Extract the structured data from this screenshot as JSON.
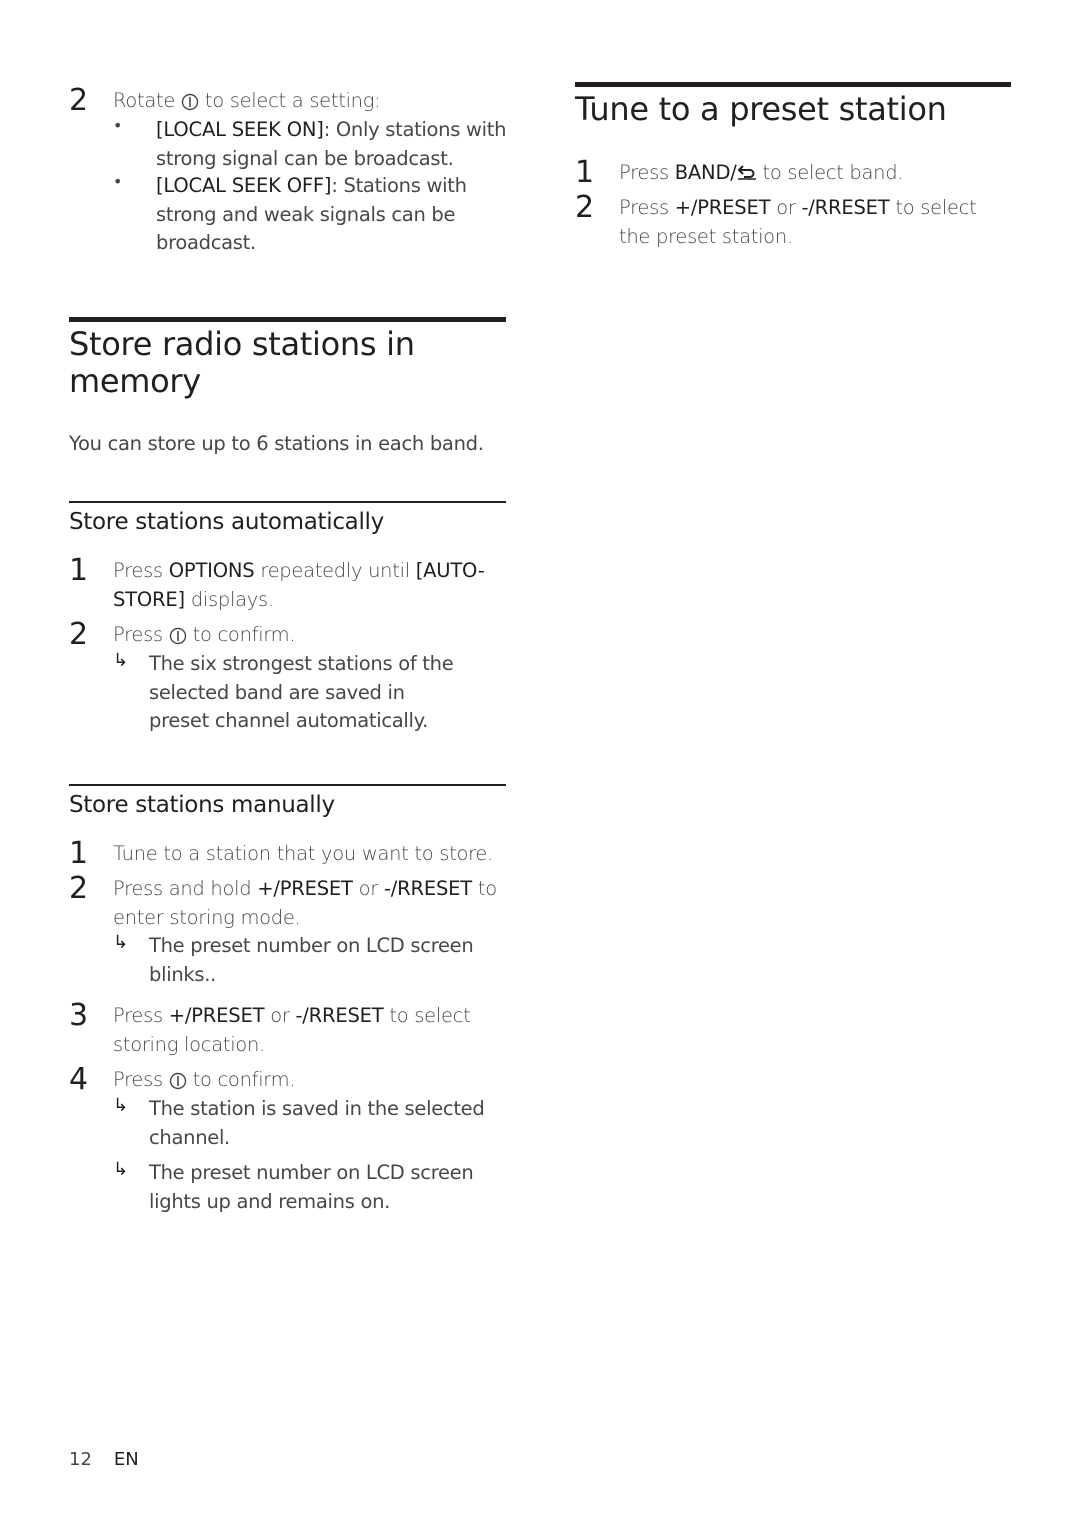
{
  "left_column": {
    "top_step": {
      "number": "2",
      "text_before": "Rotate",
      "icon": "dial-knob-icon",
      "text_after": "to select a setting:",
      "bullets": [
        {
          "mark": "•",
          "keyword": "[LOCAL SEEK ON]",
          "text": ": Only stations with strong signal can be broadcast."
        },
        {
          "mark": "•",
          "keyword": "[LOCAL SEEK OFF]",
          "text": ": Stations with strong and weak signals can be broadcast."
        }
      ]
    },
    "section": {
      "title": "Store radio stations in memory",
      "intro": "You can store up to 6 stations in each band."
    },
    "auto": {
      "title": "Store stations automatically",
      "steps": [
        {
          "number": "1",
          "pre": "Press ",
          "kw1": "OPTIONS",
          "mid": " repeatedly until ",
          "kw2": "[AUTO-STORE]",
          "post": " displays."
        },
        {
          "number": "2",
          "pre": "Press",
          "icon": "dial-knob-icon",
          "post": "to confirm."
        }
      ],
      "results": [
        {
          "arrow": "↳",
          "text": "The six strongest stations of the selected band are saved in preset channel automatically."
        }
      ]
    },
    "manual": {
      "title": "Store stations manually",
      "steps": [
        {
          "number": "1",
          "text": "Tune to a station that you want to store."
        },
        {
          "number": "2",
          "pre": "Press and hold ",
          "kw1": "+/PRESET",
          "mid": " or ",
          "kw2": "-/RRESET",
          "post": " to enter storing mode."
        },
        {
          "number": "3",
          "pre": "Press ",
          "kw1": "+/PRESET",
          "mid": " or ",
          "kw2": "-/RRESET",
          "post": " to select storing location."
        },
        {
          "number": "4",
          "pre": "Press",
          "icon": "dial-knob-icon",
          "post": "to confirm."
        }
      ],
      "results": [
        {
          "arrow": "↳",
          "text": "The preset number on LCD screen blinks.."
        },
        {
          "arrow": "↳",
          "text": "The station is saved in the selected channel."
        },
        {
          "arrow": "↳",
          "text": "The preset number on LCD screen lights up and remains on."
        }
      ]
    }
  },
  "right_column": {
    "title": "Tune to a preset station",
    "steps": [
      {
        "number": "1",
        "pre": "Press ",
        "kw1": "BAND/",
        "icon": "back-return-icon",
        "post": " to select band."
      },
      {
        "number": "2",
        "pre": "Press ",
        "kw1": "+/PRESET",
        "mid": " or ",
        "kw2": "-/RRESET",
        "post": " to select the preset station."
      }
    ]
  },
  "footer": {
    "page_number": "12",
    "language": "EN"
  },
  "colors": {
    "text_primary": "#231f20",
    "text_body": "#4a4546",
    "background": "#ffffff"
  }
}
